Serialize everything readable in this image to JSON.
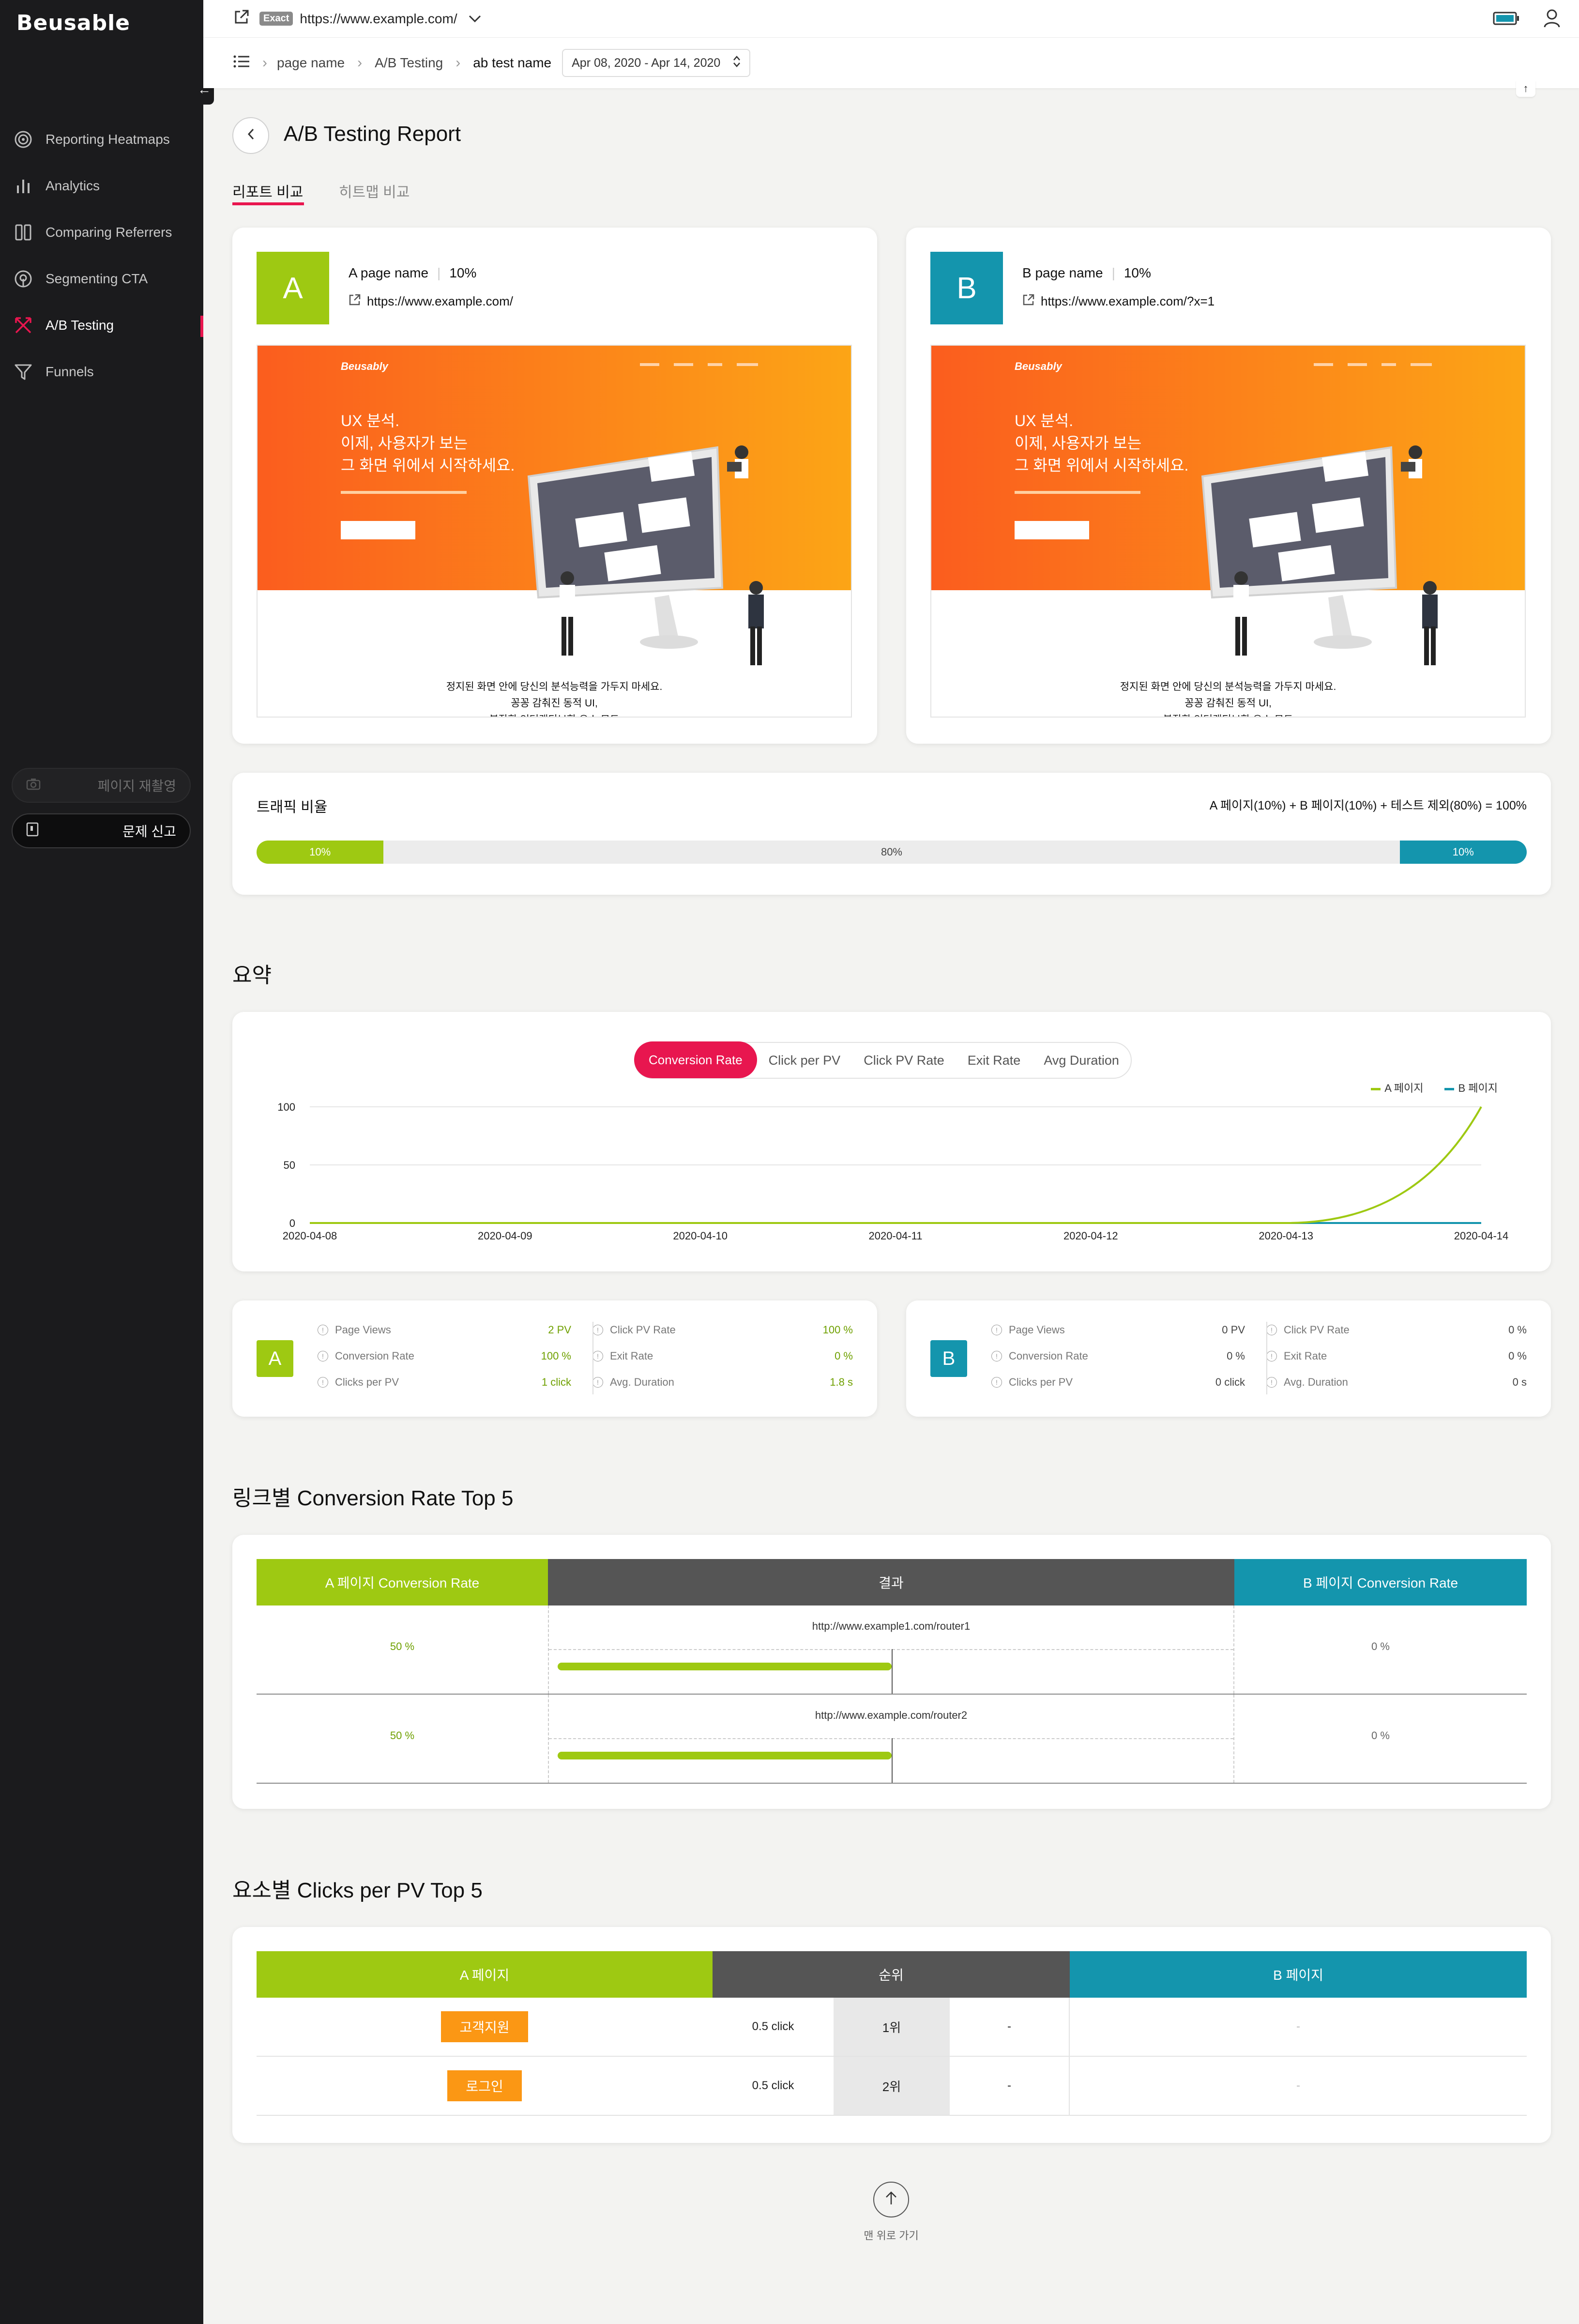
{
  "sidebar": {
    "logo": "Beusable",
    "items": [
      {
        "label": "Reporting Heatmaps",
        "icon": "heatmap-icon",
        "active": false
      },
      {
        "label": "Analytics",
        "icon": "bar-chart-icon",
        "active": false
      },
      {
        "label": "Comparing Referrers",
        "icon": "columns-icon",
        "active": false
      },
      {
        "label": "Segmenting CTA",
        "icon": "target-icon",
        "active": false
      },
      {
        "label": "A/B Testing",
        "icon": "ab-split-icon",
        "active": true
      },
      {
        "label": "Funnels",
        "icon": "funnel-icon",
        "active": false
      }
    ],
    "record_label": "페이지 재촬영",
    "report_label": "문제 신고"
  },
  "topbar": {
    "exact_badge": "Exact",
    "url": "https://www.example.com/"
  },
  "breadcrumb": {
    "page": "page name",
    "section": "A/B Testing",
    "test": "ab test name",
    "date_range": "Apr 08, 2020 - Apr 14, 2020"
  },
  "page": {
    "title": "A/B Testing Report",
    "tabs": [
      {
        "label": "리포트 비교",
        "active": true
      },
      {
        "label": "히트맵 비교",
        "active": false
      }
    ]
  },
  "variants": {
    "a": {
      "letter": "A",
      "name": "A page name",
      "ratio": "10%",
      "url": "https://www.example.com/",
      "hero_title": [
        "UX 분석.",
        "이제, 사용자가 보는",
        "그 화면 위에서 시작하세요."
      ],
      "footer_text": [
        "정지된 화면 안에 당신의 분석능력을 가두지 마세요.",
        "꽁꽁 감춰진 동적 UI,",
        "복잡한 인터랙티브한 요소 모드"
      ]
    },
    "b": {
      "letter": "B",
      "name": "B page name",
      "ratio": "10%",
      "url": "https://www.example.com/?x=1",
      "hero_title": [
        "UX 분석.",
        "이제, 사용자가 보는",
        "그 화면 위에서 시작하세요."
      ],
      "footer_text": [
        "정지된 화면 안에 당신의 분석능력을 가두지 마세요.",
        "꽁꽁 감춰진 동적 UI,",
        "복잡한 인터랙티브한 요소 모드"
      ]
    },
    "preview_brand": "Beusably"
  },
  "traffic": {
    "title": "트래픽 비율",
    "formula": "A 페이지(10%) + B 페이지(10%) + 테스트 제외(80%) = 100%",
    "a": 10,
    "excluded": 80,
    "b": 10,
    "a_label": "10%",
    "excluded_label": "80%",
    "b_label": "10%"
  },
  "summary": {
    "title": "요약",
    "metric_tabs": [
      {
        "label": "Conversion Rate",
        "active": true
      },
      {
        "label": "Click per PV",
        "active": false
      },
      {
        "label": "Click PV Rate",
        "active": false
      },
      {
        "label": "Exit Rate",
        "active": false
      },
      {
        "label": "Avg Duration",
        "active": false
      }
    ],
    "legend_a": "A 페이지",
    "legend_b": "B 페이지"
  },
  "chart_data": {
    "type": "line",
    "x": [
      "2020-04-08",
      "2020-04-09",
      "2020-04-10",
      "2020-04-11",
      "2020-04-12",
      "2020-04-13",
      "2020-04-14"
    ],
    "series": [
      {
        "name": "A 페이지",
        "values": [
          0,
          0,
          0,
          0,
          0,
          0,
          100
        ],
        "color": "#9ec912"
      },
      {
        "name": "B 페이지",
        "values": [
          0,
          0,
          0,
          0,
          0,
          0,
          0
        ],
        "color": "#1495ad"
      }
    ],
    "yticks": [
      "100",
      "50",
      "0"
    ],
    "ylim": [
      0,
      100
    ],
    "legend": "top-right"
  },
  "stats": {
    "a": {
      "letter": "A",
      "left": [
        {
          "label": "Page Views",
          "value": "2 PV"
        },
        {
          "label": "Conversion Rate",
          "value": "100 %"
        },
        {
          "label": "Clicks per PV",
          "value": "1 click"
        }
      ],
      "right": [
        {
          "label": "Click PV Rate",
          "value": "100 %"
        },
        {
          "label": "Exit Rate",
          "value": "0 %"
        },
        {
          "label": "Avg. Duration",
          "value": "1.8 s"
        }
      ]
    },
    "b": {
      "letter": "B",
      "left": [
        {
          "label": "Page Views",
          "value": "0 PV"
        },
        {
          "label": "Conversion Rate",
          "value": "0 %"
        },
        {
          "label": "Clicks per PV",
          "value": "0 click"
        }
      ],
      "right": [
        {
          "label": "Click PV Rate",
          "value": "0 %"
        },
        {
          "label": "Exit Rate",
          "value": "0 %"
        },
        {
          "label": "Avg. Duration",
          "value": "0 s"
        }
      ]
    }
  },
  "link_table": {
    "title": "링크별 Conversion Rate Top 5",
    "head_a": "A 페이지 Conversion Rate",
    "head_mid": "결과",
    "head_b": "B 페이지 Conversion Rate",
    "rows": [
      {
        "a": "50 %",
        "url": "http://www.example1.com/router1",
        "b": "0 %",
        "a_pct": 50
      },
      {
        "a": "50 %",
        "url": "http://www.example.com/router2",
        "b": "0 %",
        "a_pct": 50
      }
    ]
  },
  "element_table": {
    "title": "요소별 Clicks per PV Top 5",
    "head_a": "A 페이지",
    "head_mid": "순위",
    "head_b": "B 페이지",
    "rows": [
      {
        "element": "고객지원",
        "a_value": "0.5 click",
        "rank": "1위",
        "b_value": "-",
        "b_element": "-"
      },
      {
        "element": "로그인",
        "a_value": "0.5 click",
        "rank": "2위",
        "b_value": "-",
        "b_element": "-"
      }
    ]
  },
  "back_to_top": "맨 위로 가기",
  "colors": {
    "a": "#9ec912",
    "b": "#1495ad",
    "accent": "#e8164f",
    "mid": "#555555"
  }
}
